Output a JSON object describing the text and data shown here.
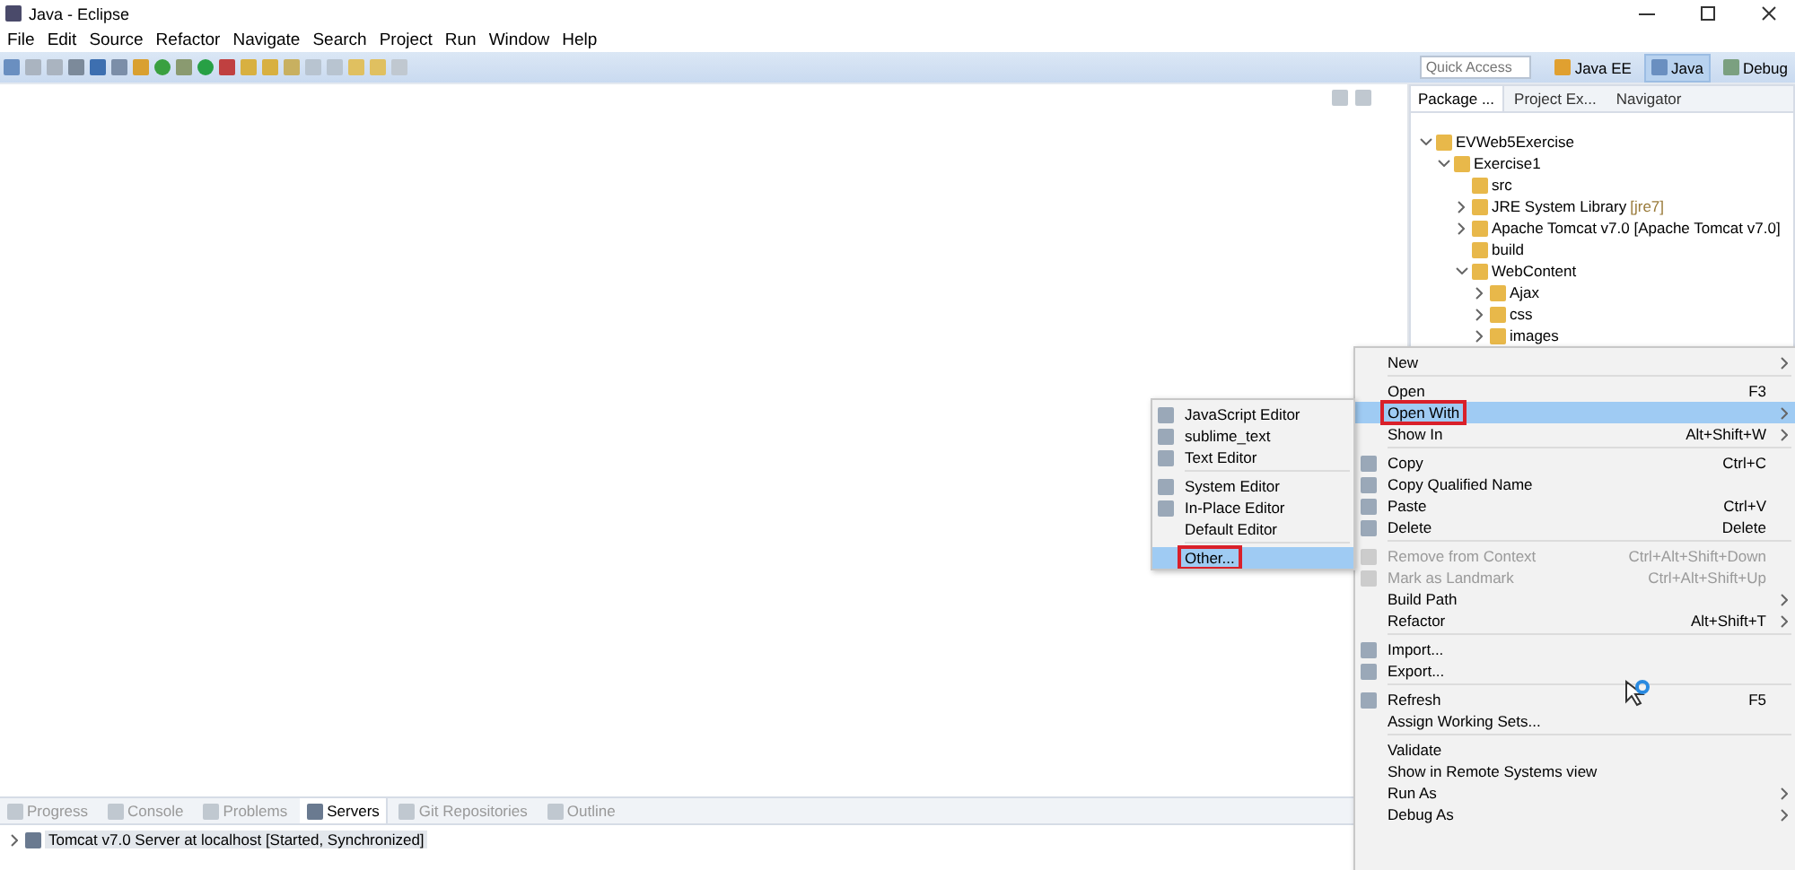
{
  "window": {
    "title": "Java - Eclipse"
  },
  "menu_bar": [
    "File",
    "Edit",
    "Source",
    "Refactor",
    "Navigate",
    "Search",
    "Project",
    "Run",
    "Window",
    "Help"
  ],
  "quick_access": {
    "placeholder": "Quick Access"
  },
  "perspectives": [
    {
      "label": "Java EE",
      "selected": false
    },
    {
      "label": "Java",
      "selected": true
    },
    {
      "label": "Debug",
      "selected": false
    }
  ],
  "explorer": {
    "tabs": [
      {
        "label": "Package ...",
        "selected": true
      },
      {
        "label": "Project Ex...",
        "selected": false
      },
      {
        "label": "Navigator",
        "selected": false
      }
    ],
    "tree": [
      {
        "label": "EVWeb5Exercise",
        "expanded": true,
        "children": [
          {
            "label": "Exercise1",
            "expanded": true,
            "children": [
              {
                "label": "src"
              },
              {
                "label": "JRE System Library",
                "decoration": "[jre7]",
                "expanded": false
              },
              {
                "label": "Apache Tomcat v7.0 [Apache Tomcat v7.0]",
                "expanded": false
              },
              {
                "label": "build"
              },
              {
                "label": "WebContent",
                "expanded": true,
                "children": [
                  {
                    "label": "Ajax",
                    "expanded": false
                  },
                  {
                    "label": "css",
                    "expanded": false
                  },
                  {
                    "label": "images",
                    "expanded": false
                  }
                ]
              }
            ]
          }
        ]
      }
    ]
  },
  "bottom_panel": {
    "tabs": [
      {
        "label": "Progress",
        "selected": false
      },
      {
        "label": "Console",
        "selected": false
      },
      {
        "label": "Problems",
        "selected": false
      },
      {
        "label": "Servers",
        "selected": true
      },
      {
        "label": "Git Repositories",
        "selected": false
      },
      {
        "label": "Outline",
        "selected": false
      }
    ],
    "servers": [
      {
        "label": "Tomcat v7.0 Server at localhost  [Started, Synchronized]",
        "expanded": false
      }
    ]
  },
  "context_menu": {
    "groups": [
      {
        "items": [
          {
            "label": "New",
            "submenu": true,
            "icon": false,
            "selected": false,
            "disabled": false,
            "annotated": false
          }
        ]
      },
      {
        "items": [
          {
            "label": "Open",
            "shortcut": "F3",
            "submenu": false,
            "icon": false,
            "selected": false,
            "disabled": false,
            "annotated": false
          },
          {
            "label": "Open With",
            "submenu": true,
            "icon": false,
            "selected": true,
            "disabled": false,
            "annotated": true
          },
          {
            "label": "Show In",
            "shortcut": "Alt+Shift+W",
            "submenu": true,
            "icon": false,
            "selected": false,
            "disabled": false,
            "annotated": false
          }
        ]
      },
      {
        "items": [
          {
            "label": "Copy",
            "shortcut": "Ctrl+C",
            "submenu": false,
            "icon": true,
            "selected": false,
            "disabled": false,
            "annotated": false
          },
          {
            "label": "Copy Qualified Name",
            "submenu": false,
            "icon": true,
            "selected": false,
            "disabled": false,
            "annotated": false
          },
          {
            "label": "Paste",
            "shortcut": "Ctrl+V",
            "submenu": false,
            "icon": true,
            "selected": false,
            "disabled": false,
            "annotated": false
          },
          {
            "label": "Delete",
            "shortcut": "Delete",
            "submenu": false,
            "icon": true,
            "selected": false,
            "disabled": false,
            "annotated": false
          }
        ]
      },
      {
        "items": [
          {
            "label": "Remove from Context",
            "shortcut": "Ctrl+Alt+Shift+Down",
            "submenu": false,
            "icon": true,
            "selected": false,
            "disabled": true,
            "annotated": false
          },
          {
            "label": "Mark as Landmark",
            "shortcut": "Ctrl+Alt+Shift+Up",
            "submenu": false,
            "icon": true,
            "selected": false,
            "disabled": true,
            "annotated": false
          },
          {
            "label": "Build Path",
            "submenu": true,
            "icon": false,
            "selected": false,
            "disabled": false,
            "annotated": false
          },
          {
            "label": "Refactor",
            "shortcut": "Alt+Shift+T",
            "submenu": true,
            "icon": false,
            "selected": false,
            "disabled": false,
            "annotated": false
          }
        ]
      },
      {
        "items": [
          {
            "label": "Import...",
            "submenu": false,
            "icon": true,
            "selected": false,
            "disabled": false,
            "annotated": false
          },
          {
            "label": "Export...",
            "submenu": false,
            "icon": true,
            "selected": false,
            "disabled": false,
            "annotated": false
          }
        ]
      },
      {
        "items": [
          {
            "label": "Refresh",
            "shortcut": "F5",
            "submenu": false,
            "icon": true,
            "selected": false,
            "disabled": false,
            "annotated": false
          },
          {
            "label": "Assign Working Sets...",
            "submenu": false,
            "icon": false,
            "selected": false,
            "disabled": false,
            "annotated": false
          }
        ]
      },
      {
        "items": [
          {
            "label": "Validate",
            "submenu": false,
            "icon": false,
            "selected": false,
            "disabled": false,
            "annotated": false
          },
          {
            "label": "Show in Remote Systems view",
            "submenu": false,
            "icon": false,
            "selected": false,
            "disabled": false,
            "annotated": false
          },
          {
            "label": "Run As",
            "submenu": true,
            "icon": false,
            "selected": false,
            "disabled": false,
            "annotated": false
          },
          {
            "label": "Debug As",
            "submenu": true,
            "icon": false,
            "selected": false,
            "disabled": false,
            "annotated": false
          }
        ]
      }
    ]
  },
  "open_with_menu": {
    "groups": [
      {
        "items": [
          {
            "label": "JavaScript Editor",
            "icon": true,
            "selected": false,
            "annotated": false
          },
          {
            "label": "sublime_text",
            "icon": true,
            "selected": false,
            "annotated": false
          },
          {
            "label": "Text Editor",
            "icon": true,
            "selected": false,
            "annotated": false
          }
        ]
      },
      {
        "items": [
          {
            "label": "System Editor",
            "icon": true,
            "selected": false,
            "annotated": false
          },
          {
            "label": "In-Place Editor",
            "icon": true,
            "selected": false,
            "annotated": false
          },
          {
            "label": "Default Editor",
            "icon": false,
            "selected": false,
            "annotated": false
          }
        ]
      },
      {
        "items": [
          {
            "label": "Other...",
            "icon": false,
            "selected": true,
            "annotated": true
          }
        ]
      }
    ]
  }
}
